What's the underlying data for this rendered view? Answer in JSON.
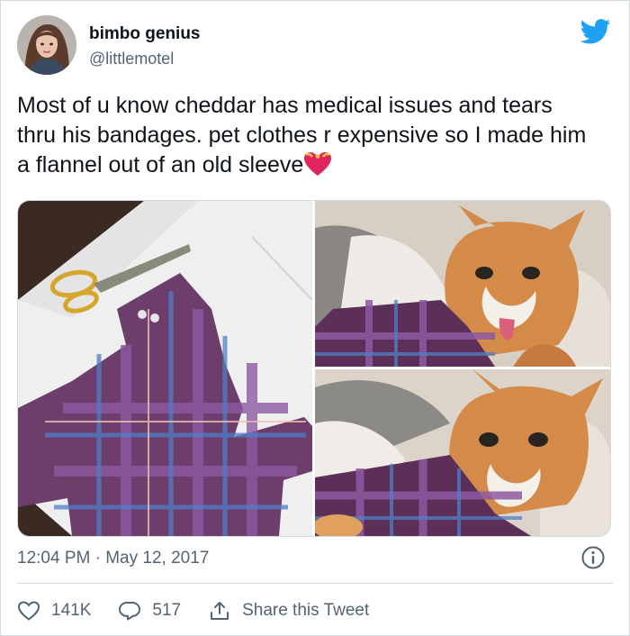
{
  "tweet": {
    "display_name": "bimbo genius",
    "handle": "@littlemotel",
    "text": "Most of u know cheddar has medical issues and tears thru his bandages. pet clothes r expensive so I made him a flannel out of an old sleeve",
    "emoji": "heart-with-ribbon",
    "timestamp": "12:04 PM · May 12, 2017"
  },
  "actions": {
    "likes": "141K",
    "replies": "517",
    "share_label": "Share this Tweet"
  },
  "colors": {
    "twitter_blue": "#1da1f2",
    "secondary_text": "#536471",
    "heart_red": "#e0245e"
  },
  "icons": [
    "twitter-bird-icon",
    "info-icon",
    "like-heart-icon",
    "reply-bubble-icon",
    "share-icon"
  ]
}
